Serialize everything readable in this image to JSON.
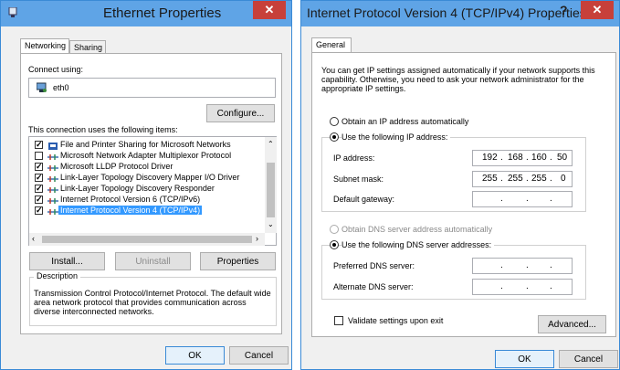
{
  "left_dialog": {
    "title": "Ethernet Properties",
    "close_glyph": "✕",
    "tabs": [
      {
        "label": "Networking"
      },
      {
        "label": "Sharing"
      }
    ],
    "connect_using_label": "Connect using:",
    "adapter_name": "eth0",
    "configure_label": "Configure...",
    "items_label": "This connection uses the following items:",
    "items": [
      {
        "label": "File and Printer Sharing for Microsoft Networks",
        "checked": true,
        "icon": "printer-icon"
      },
      {
        "label": "Microsoft Network Adapter Multiplexor Protocol",
        "checked": false,
        "icon": "protocol-icon"
      },
      {
        "label": "Microsoft LLDP Protocol Driver",
        "checked": true,
        "icon": "protocol-icon"
      },
      {
        "label": "Link-Layer Topology Discovery Mapper I/O Driver",
        "checked": true,
        "icon": "protocol-icon"
      },
      {
        "label": "Link-Layer Topology Discovery Responder",
        "checked": true,
        "icon": "protocol-icon"
      },
      {
        "label": "Internet Protocol Version 6 (TCP/IPv6)",
        "checked": true,
        "icon": "protocol-icon"
      },
      {
        "label": "Internet Protocol Version 4 (TCP/IPv4)",
        "checked": true,
        "icon": "protocol-icon",
        "selected": true
      }
    ],
    "install_label": "Install...",
    "uninstall_label": "Uninstall",
    "properties_label": "Properties",
    "description_title": "Description",
    "description_text": "Transmission Control Protocol/Internet Protocol. The default wide area network protocol that provides communication across diverse interconnected networks.",
    "ok_label": "OK",
    "cancel_label": "Cancel"
  },
  "right_dialog": {
    "title": "Internet Protocol Version 4 (TCP/IPv4) Properties",
    "help_glyph": "?",
    "close_glyph": "✕",
    "tab_label": "General",
    "intro_text": "You can get IP settings assigned automatically if your network supports this capability. Otherwise, you need to ask your network administrator for the appropriate IP settings.",
    "obtain_ip_label": "Obtain an IP address automatically",
    "use_ip_label": "Use the following IP address:",
    "ip_address_label": "IP address:",
    "ip_address": [
      "192",
      "168",
      "160",
      "50"
    ],
    "subnet_label": "Subnet mask:",
    "subnet_mask": [
      "255",
      "255",
      "255",
      "0"
    ],
    "gateway_label": "Default gateway:",
    "obtain_dns_label": "Obtain DNS server address automatically",
    "use_dns_label": "Use the following DNS server addresses:",
    "preferred_dns_label": "Preferred DNS server:",
    "alternate_dns_label": "Alternate DNS server:",
    "validate_label": "Validate settings upon exit",
    "advanced_label": "Advanced...",
    "ok_label": "OK",
    "cancel_label": "Cancel",
    "dot": "."
  }
}
